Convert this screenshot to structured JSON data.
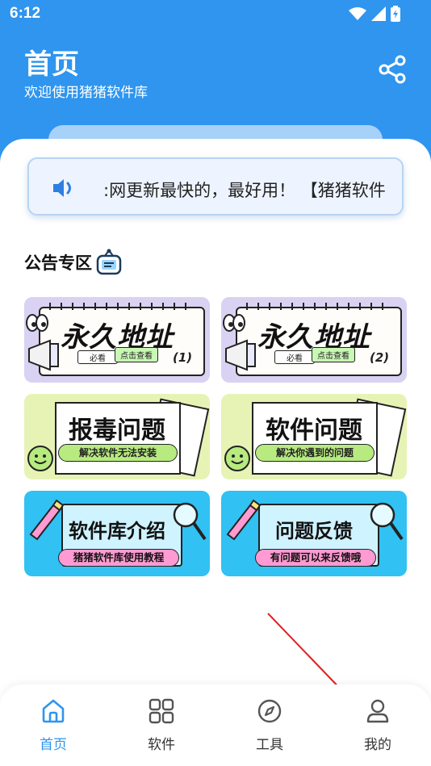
{
  "status_bar": {
    "time": "6:12"
  },
  "header": {
    "title": "首页",
    "subtitle": "欢迎使用猪猪软件库",
    "share_icon": "share-icon"
  },
  "notice": {
    "icon": "speaker-icon",
    "text": ":网更新最快的，最好用！ 【猪猪软件"
  },
  "announcements": {
    "title": "公告专区",
    "cards": [
      {
        "headline": "永久地址",
        "tag1": "必看",
        "tag2": "点击查看",
        "number": "(1)"
      },
      {
        "headline": "永久地址",
        "tag1": "必看",
        "tag2": "点击查看",
        "number": "(2)"
      },
      {
        "headline": "报毒问题",
        "tag": "解决软件无法安装"
      },
      {
        "headline": "软件问题",
        "tag": "解决你遇到的问题"
      },
      {
        "headline": "软件库介绍",
        "tag": "猪猪软件库使用教程"
      },
      {
        "headline": "问题反馈",
        "tag": "有问题可以来反馈哦"
      }
    ]
  },
  "bottom_nav": {
    "items": [
      {
        "label": "首页",
        "icon": "home-icon",
        "active": true
      },
      {
        "label": "软件",
        "icon": "grid-icon",
        "active": false
      },
      {
        "label": "工具",
        "icon": "compass-icon",
        "active": false
      },
      {
        "label": "我的",
        "icon": "user-icon",
        "active": false
      }
    ]
  },
  "colors": {
    "primary": "#2f95ee",
    "annotation_arrow": "#e02020"
  }
}
